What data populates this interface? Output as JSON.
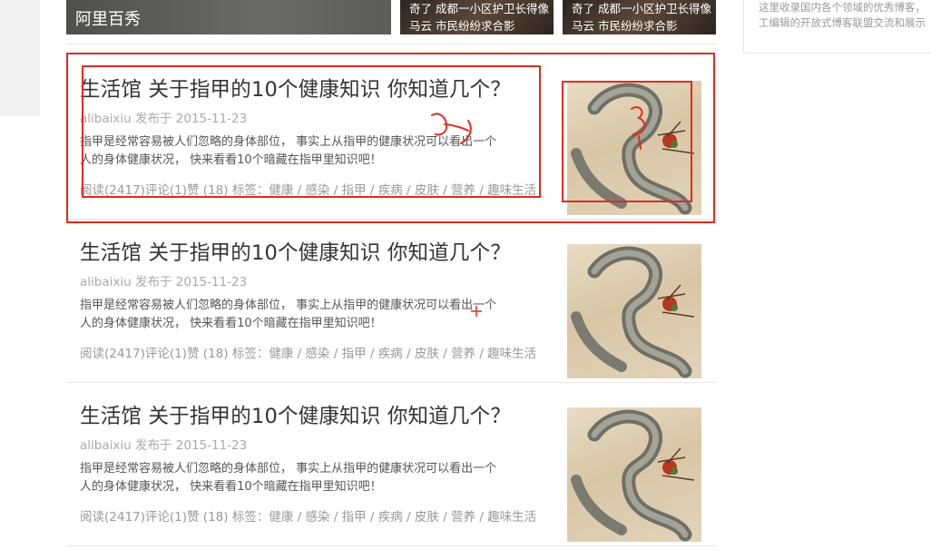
{
  "banner": {
    "title": "阿里百秀",
    "news": [
      {
        "line1": "奇了 成都一小区护卫长得像",
        "line2": "马云 市民纷纷求合影"
      },
      {
        "line1": "奇了 成都一小区护卫长得像",
        "line2": "马云 市民纷纷求合影"
      }
    ]
  },
  "sidebar": {
    "intro_line1": "这里收录国内各个领域的优秀博客，",
    "intro_line2": "工编辑的开放式博客联盟交流和展示"
  },
  "articles": [
    {
      "title": "生活馆 关于指甲的10个健康知识 你知道几个？",
      "author": "alibaixiu",
      "published_label": "发布于",
      "date": "2015-11-23",
      "summary_line1": "指甲是经常容易被人们忽略的身体部位， 事实上从指甲的健康状况可以看出一个",
      "summary_line2": "人的身体健康状况， 快来看看10个暗藏在指甲里知识吧！",
      "reads": "阅读(2417)",
      "comments": "评论(1)",
      "likes": "赞 (18)",
      "tags_label": "标签：",
      "tags": [
        "健康",
        "感染",
        "指甲",
        "疾病",
        "皮肤",
        "营养",
        "趣味生活"
      ]
    },
    {
      "title": "生活馆 关于指甲的10个健康知识 你知道几个？",
      "author": "alibaixiu",
      "published_label": "发布于",
      "date": "2015-11-23",
      "summary_line1": "指甲是经常容易被人们忽略的身体部位， 事实上从指甲的健康状况可以看出一个",
      "summary_line2": "人的身体健康状况， 快来看看10个暗藏在指甲里知识吧！",
      "reads": "阅读(2417)",
      "comments": "评论(1)",
      "likes": "赞 (18)",
      "tags_label": "标签：",
      "tags": [
        "健康",
        "感染",
        "指甲",
        "疾病",
        "皮肤",
        "营养",
        "趣味生活"
      ]
    },
    {
      "title": "生活馆 关于指甲的10个健康知识 你知道几个？",
      "author": "alibaixiu",
      "published_label": "发布于",
      "date": "2015-11-23",
      "summary_line1": "指甲是经常容易被人们忽略的身体部位， 事实上从指甲的健康状况可以看出一个",
      "summary_line2": "人的身体健康状况， 快来看看10个暗藏在指甲里知识吧！",
      "reads": "阅读(2417)",
      "comments": "评论(1)",
      "likes": "赞 (18)",
      "tags_label": "标签：",
      "tags": [
        "健康",
        "感染",
        "指甲",
        "疾病",
        "皮肤",
        "营养",
        "趣味生活"
      ]
    }
  ],
  "colors": {
    "annotation": "#e02b1f",
    "divider": "#e6e6e6"
  }
}
